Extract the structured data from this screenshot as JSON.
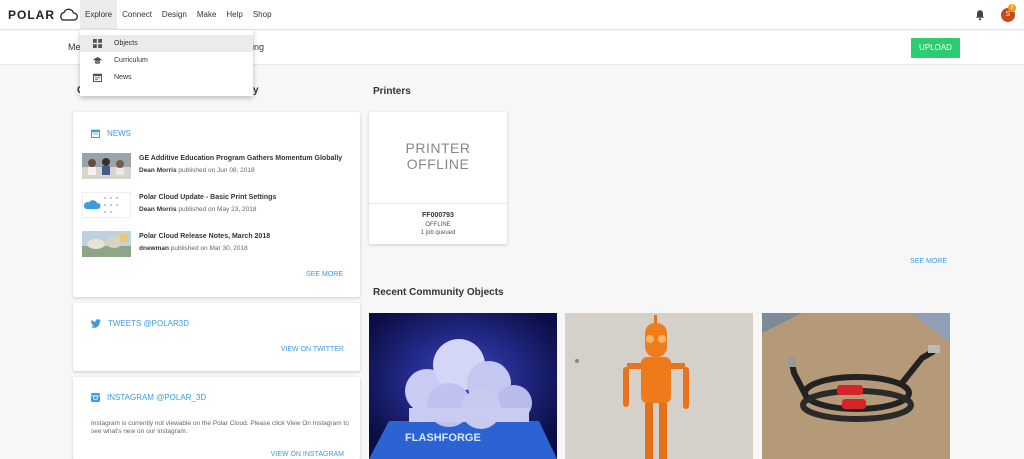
{
  "header": {
    "logo_text": "POLAR",
    "menu": [
      {
        "label": "Explore"
      },
      {
        "label": "Connect"
      },
      {
        "label": "Design"
      },
      {
        "label": "Make"
      },
      {
        "label": "Help"
      },
      {
        "label": "Shop"
      }
    ],
    "avatar_initial": "S",
    "notification_count": "2"
  },
  "explore_dropdown": {
    "items": [
      {
        "label": "Objects",
        "icon": "grid-icon"
      },
      {
        "label": "Curriculum",
        "icon": "graduation-cap-icon"
      },
      {
        "label": "News",
        "icon": "calendar-icon"
      }
    ]
  },
  "subbar": {
    "left_partial": "Me",
    "right_partial": "ing",
    "upload_label": "UPLOAD"
  },
  "left_column": {
    "title_partial": "C",
    "title_partial_tail": "y"
  },
  "news": {
    "heading": "NEWS",
    "items": [
      {
        "title": "GE Additive Education Program Gathers Momentum Globally",
        "author": "Dean Morris",
        "meta": " published on Jun 08, 2018"
      },
      {
        "title": "Polar Cloud Update - Basic Print Settings",
        "author": "Dean Morris",
        "meta": " published on May 23, 2018"
      },
      {
        "title": "Polar Cloud Release Notes, March 2018",
        "author": "dnewman",
        "meta": " published on Mar 30, 2018"
      }
    ],
    "see_more": "SEE MORE"
  },
  "tweets": {
    "heading": "TWEETS @POLAR3D",
    "link": "VIEW ON TWITTER"
  },
  "instagram": {
    "heading": "INSTAGRAM @POLAR_3D",
    "text": "Instagram is currently not viewable on the Polar Cloud. Please click View On Instagram to see what's new on our instagram.",
    "link": "VIEW ON INSTAGRAM"
  },
  "printers": {
    "title": "Printers",
    "offline_line1": "PRINTER",
    "offline_line2": "OFFLINE",
    "name": "FF000793",
    "status": "OFFLINE",
    "jobs": "1 job queued",
    "see_more": "SEE MORE"
  },
  "community": {
    "title": "Recent Community Objects",
    "flashforge_text": "FLASHFORGE"
  },
  "colors": {
    "accent": "#3c9be0",
    "upload_green": "#2ecc71",
    "avatar": "#c54a1a"
  }
}
